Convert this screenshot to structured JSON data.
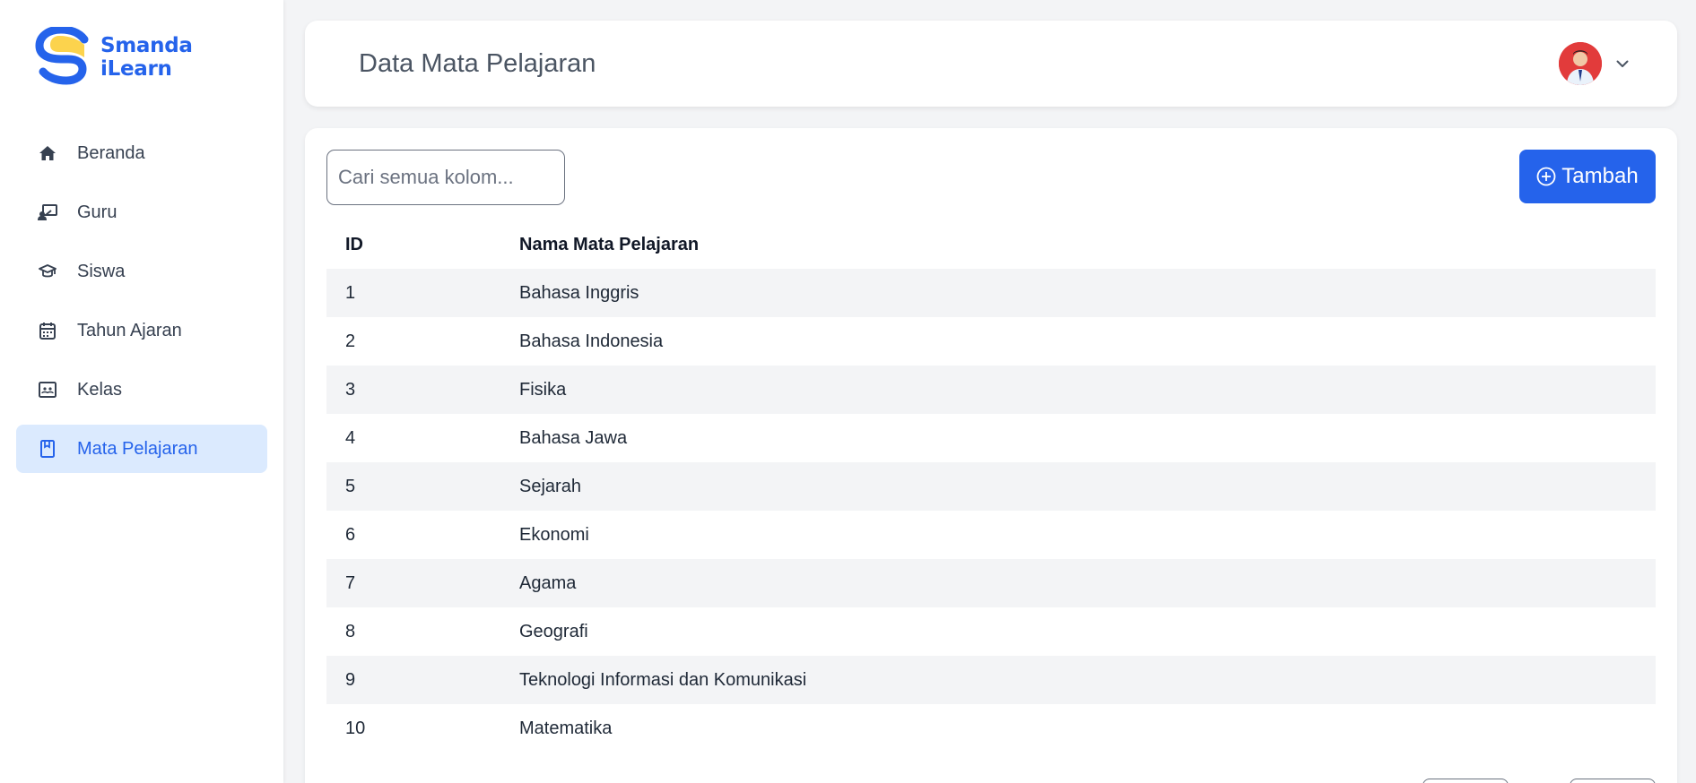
{
  "app": {
    "logo_line1": "Smanda",
    "logo_line2": "iLearn"
  },
  "colors": {
    "accent": "#2563eb",
    "active_bg": "#dbeafe",
    "logo_yellow": "#fcd34d",
    "row_stripe": "#f3f4f6"
  },
  "sidebar": {
    "items": [
      {
        "label": "Beranda",
        "icon": "home-icon"
      },
      {
        "label": "Guru",
        "icon": "teacher-icon"
      },
      {
        "label": "Siswa",
        "icon": "student-cap-icon"
      },
      {
        "label": "Tahun Ajaran",
        "icon": "calendar-icon"
      },
      {
        "label": "Kelas",
        "icon": "classroom-icon"
      },
      {
        "label": "Mata Pelajaran",
        "icon": "book-icon",
        "active": true
      }
    ]
  },
  "header": {
    "title": "Data Mata Pelajaran",
    "user_menu_icon": "chevron-down-icon"
  },
  "toolbar": {
    "search_placeholder": "Cari semua kolom...",
    "add_label": "Tambah",
    "add_icon": "plus-circle-icon"
  },
  "table": {
    "columns": [
      "ID",
      "Nama Mata Pelajaran"
    ],
    "rows": [
      {
        "id": "1",
        "name": "Bahasa Inggris"
      },
      {
        "id": "2",
        "name": "Bahasa Indonesia"
      },
      {
        "id": "3",
        "name": "Fisika"
      },
      {
        "id": "4",
        "name": "Bahasa Jawa"
      },
      {
        "id": "5",
        "name": "Sejarah"
      },
      {
        "id": "6",
        "name": "Ekonomi"
      },
      {
        "id": "7",
        "name": "Agama"
      },
      {
        "id": "8",
        "name": "Geografi"
      },
      {
        "id": "9",
        "name": "Teknologi Informasi dan Komunikasi"
      },
      {
        "id": "10",
        "name": "Matematika"
      }
    ]
  }
}
